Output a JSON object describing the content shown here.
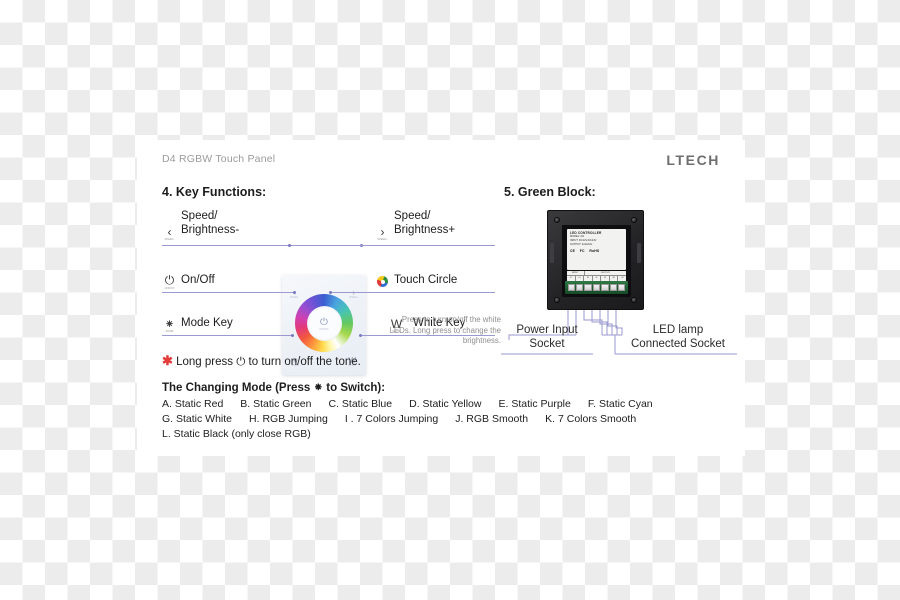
{
  "document": {
    "title": "D4 RGBW Touch Panel",
    "brand": "LTECH"
  },
  "sections": {
    "key_functions": {
      "heading": "4. Key Functions:",
      "left_items": [
        {
          "label_line1": "Speed/",
          "label_line2": "Brightness-",
          "icon": "chevron-left-icon",
          "icon_glyph": "‹",
          "icon_sub": "SPEED-"
        },
        {
          "label_line1": "On/Off",
          "label_line2": "",
          "icon": "power-icon",
          "icon_glyph": "⏻",
          "icon_sub": "ON/OFF"
        },
        {
          "label_line1": "Mode Key",
          "label_line2": "",
          "icon": "mode-icon",
          "icon_glyph": "⁕",
          "icon_sub": "MODE"
        }
      ],
      "right_items": [
        {
          "label_line1": "Speed/",
          "label_line2": "Brightness+",
          "icon": "chevron-right-icon",
          "icon_glyph": "›",
          "icon_sub": "SPEED+"
        },
        {
          "label_line1": "Touch Circle",
          "label_line2": "",
          "icon": "color-circle-icon",
          "icon_glyph": "",
          "icon_sub": ""
        },
        {
          "label_line1": "White Key",
          "label_line2": "",
          "icon": "white-key-icon",
          "icon_glyph": "W",
          "icon_sub": "WHITE"
        }
      ],
      "white_key_note": "Press to turn on/off the white LEDs. Long press to change the brightness.",
      "panel": {
        "buttons": [
          {
            "name": "prev-button",
            "glyph": "‹",
            "sub": "SPEED-"
          },
          {
            "name": "next-button",
            "glyph": "›",
            "sub": "SPEED+"
          },
          {
            "name": "mode-button",
            "glyph": "⁕",
            "sub": "MODE"
          },
          {
            "name": "white-button",
            "glyph": "W",
            "sub": "WHITE"
          }
        ],
        "center_glyph": "⏻",
        "center_sub": "ON/OFF"
      }
    },
    "tone_note": {
      "star": "✱",
      "text_before": "Long press",
      "icon_glyph": "⏻",
      "text_after": "to turn on/off the tone."
    },
    "changing_mode": {
      "title_before": "The Changing Mode (Press",
      "title_icon": "⁕",
      "title_after": "to Switch):",
      "rows": [
        [
          "A. Static Red",
          "B. Static Green",
          "C. Static Blue",
          "D. Static Yellow",
          "E. Static Purple",
          "F. Static Cyan"
        ],
        [
          "G. Static White",
          "H. RGB Jumping",
          "I . 7 Colors Jumping",
          "J. RGB Smooth",
          "K. 7 Colors Smooth"
        ],
        [
          "L. Static Black (only close RGB)"
        ]
      ]
    },
    "green_block": {
      "heading": "5. Green Block:",
      "device_label": {
        "title": "LED CONTROLLER",
        "lines": [
          "MODEL: D4",
          "INPUT: DC12V-DC24V",
          "OUTPUT: 4x4A/CH"
        ],
        "certs": [
          "CE",
          "FC",
          "RoHS"
        ],
        "terminal_table": {
          "header": [
            "INPUT",
            "OUTPUT"
          ],
          "cells": [
            "-V",
            "+V",
            "R",
            "G",
            "B",
            "W",
            "+V"
          ]
        }
      },
      "terminal_count": 7,
      "labels": {
        "power_input": "Power Input\nSocket",
        "power_input_line1": "Power Input",
        "power_input_line2": "Socket",
        "led_lamp_line1": "LED lamp",
        "led_lamp_line2": "Connected Socket"
      }
    }
  },
  "colors": {
    "accent_rule": "#9a9ad0",
    "star_red": "#e23c3c",
    "green_terminal": "#1f5c33",
    "text": "#1d1d1d",
    "muted": "#8e8e8e"
  }
}
